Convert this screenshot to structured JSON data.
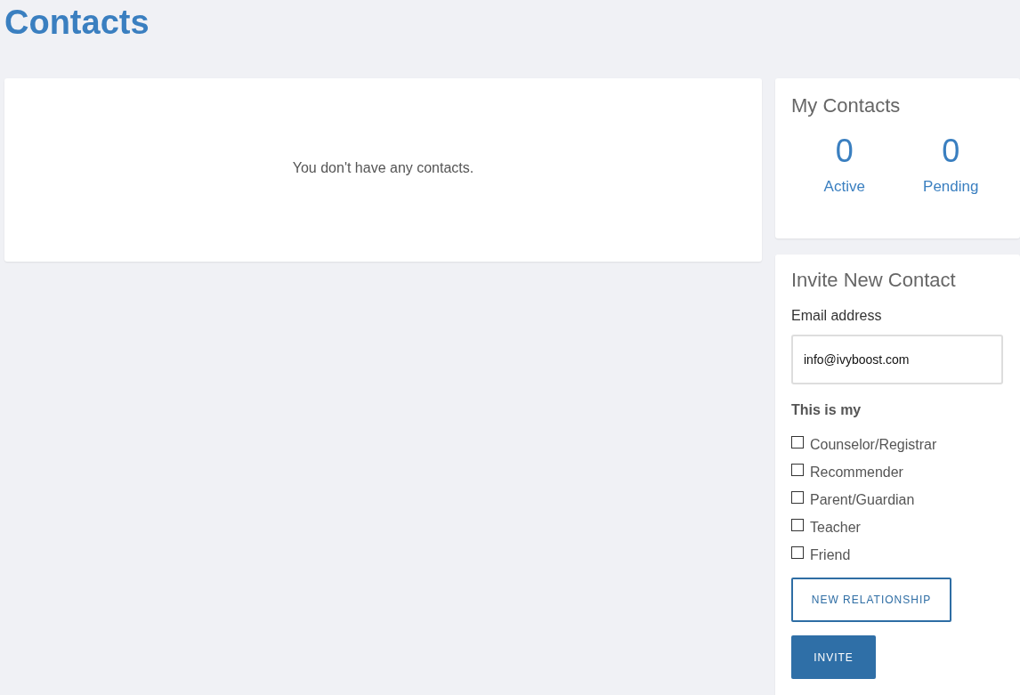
{
  "page_title": "Contacts",
  "contacts_panel": {
    "empty_message": "You don't have any contacts."
  },
  "my_contacts": {
    "title": "My Contacts",
    "stats": [
      {
        "value": "0",
        "label": "Active"
      },
      {
        "value": "0",
        "label": "Pending"
      }
    ]
  },
  "invite": {
    "title": "Invite New Contact",
    "email_label": "Email address",
    "email_value": "info@ivyboost.com",
    "relation_label": "This is my",
    "relations": [
      {
        "label": "Counselor/Registrar",
        "checked": false
      },
      {
        "label": "Recommender",
        "checked": false
      },
      {
        "label": "Parent/Guardian",
        "checked": false
      },
      {
        "label": "Teacher",
        "checked": false
      },
      {
        "label": "Friend",
        "checked": false
      }
    ],
    "buttons": [
      {
        "label": "NEW RELATIONSHIP",
        "kind": "outline"
      },
      {
        "label": "INVITE",
        "kind": "primary"
      }
    ]
  }
}
